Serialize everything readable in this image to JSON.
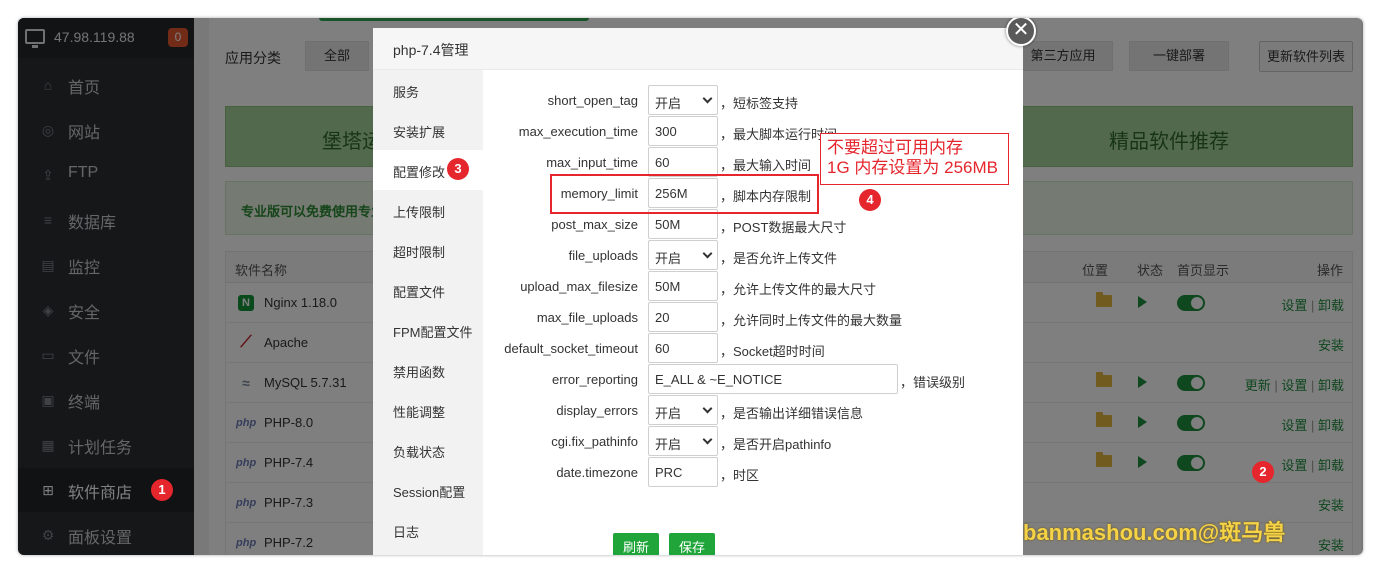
{
  "sidebar": {
    "ip": "47.98.119.88",
    "ip_badge": "0",
    "items": [
      {
        "label": "首页",
        "icon": "home-icon",
        "glyph": "⌂"
      },
      {
        "label": "网站",
        "icon": "globe-icon",
        "glyph": "◎"
      },
      {
        "label": "FTP",
        "icon": "ftp-icon",
        "glyph": "⇪"
      },
      {
        "label": "数据库",
        "icon": "database-icon",
        "glyph": "≡"
      },
      {
        "label": "监控",
        "icon": "monitor-chart-icon",
        "glyph": "▤"
      },
      {
        "label": "安全",
        "icon": "shield-icon",
        "glyph": "◈"
      },
      {
        "label": "文件",
        "icon": "folder-icon",
        "glyph": "▭"
      },
      {
        "label": "终端",
        "icon": "terminal-icon",
        "glyph": "▣"
      },
      {
        "label": "计划任务",
        "icon": "calendar-icon",
        "glyph": "▦"
      },
      {
        "label": "软件商店",
        "icon": "grid-icon",
        "glyph": "⊞"
      },
      {
        "label": "面板设置",
        "icon": "gear-icon",
        "glyph": "⚙"
      }
    ],
    "active_index": 9
  },
  "main": {
    "category_label": "应用分类",
    "categories": [
      "全部",
      "第三方应用",
      "一键部署"
    ],
    "refresh_list": "更新软件列表",
    "banner_left": "堡塔运",
    "banner_right": "精品软件推荐",
    "pro_notice": "专业版可以免费使用专业",
    "table_headers": {
      "name": "软件名称",
      "location": "位置",
      "status": "状态",
      "home": "首页显示",
      "ops": "操作"
    },
    "rows": [
      {
        "name": "Nginx 1.18.0",
        "icon": "N",
        "kind": "nginx",
        "installed": true,
        "ops": [
          "设置",
          "卸载"
        ]
      },
      {
        "name": "Apache",
        "icon": "⟋",
        "kind": "apache",
        "installed": false,
        "ops": [
          "安装"
        ]
      },
      {
        "name": "MySQL 5.7.31",
        "icon": "≈",
        "kind": "mysql",
        "installed": true,
        "ops": [
          "更新",
          "设置",
          "卸载"
        ]
      },
      {
        "name": "PHP-8.0",
        "icon": "php",
        "kind": "php",
        "installed": true,
        "ops": [
          "设置",
          "卸载"
        ]
      },
      {
        "name": "PHP-7.4",
        "icon": "php",
        "kind": "php",
        "installed": true,
        "ops": [
          "设置",
          "卸载"
        ]
      },
      {
        "name": "PHP-7.3",
        "icon": "php",
        "kind": "php",
        "installed": false,
        "ops": [
          "安装"
        ]
      },
      {
        "name": "PHP-7.2",
        "icon": "php",
        "kind": "php",
        "installed": false,
        "ops": [
          "安装"
        ]
      }
    ]
  },
  "modal": {
    "title": "php-7.4管理",
    "close_glyph": "✕",
    "tabs": [
      "服务",
      "安装扩展",
      "配置修改",
      "上传限制",
      "超时限制",
      "配置文件",
      "FPM配置文件",
      "禁用函数",
      "性能调整",
      "负载状态",
      "Session配置",
      "日志"
    ],
    "active_tab": 2,
    "fields": [
      {
        "label": "short_open_tag",
        "value": "开启",
        "type": "select",
        "desc": "，短标签支持"
      },
      {
        "label": "max_execution_time",
        "value": "300",
        "type": "input",
        "desc": "，最大脚本运行时间"
      },
      {
        "label": "max_input_time",
        "value": "60",
        "type": "input",
        "desc": "，最大输入时间"
      },
      {
        "label": "memory_limit",
        "value": "256M",
        "type": "input",
        "desc": "，脚本内存限制"
      },
      {
        "label": "post_max_size",
        "value": "50M",
        "type": "input",
        "desc": "，POST数据最大尺寸"
      },
      {
        "label": "file_uploads",
        "value": "开启",
        "type": "select",
        "desc": "，是否允许上传文件"
      },
      {
        "label": "upload_max_filesize",
        "value": "50M",
        "type": "input",
        "desc": "，允许上传文件的最大尺寸"
      },
      {
        "label": "max_file_uploads",
        "value": "20",
        "type": "input",
        "desc": "，允许同时上传文件的最大数量"
      },
      {
        "label": "default_socket_timeout",
        "value": "60",
        "type": "input",
        "desc": "，Socket超时时间"
      },
      {
        "label": "error_reporting",
        "value": "E_ALL & ~E_NOTICE",
        "type": "wide",
        "desc": "，错误级别"
      },
      {
        "label": "display_errors",
        "value": "开启",
        "type": "select",
        "desc": "，是否输出详细错误信息"
      },
      {
        "label": "cgi.fix_pathinfo",
        "value": "开启",
        "type": "select",
        "desc": "，是否开启pathinfo"
      },
      {
        "label": "date.timezone",
        "value": "PRC",
        "type": "input",
        "desc": "，时区"
      }
    ],
    "refresh_label": "刷新",
    "save_label": "保存"
  },
  "annotations": {
    "note_line1": "不要超过可用内存",
    "note_line2": "1G 内存设置为 256MB",
    "step1": "1",
    "step2": "2",
    "step3": "3",
    "step4": "4",
    "watermark": "banmashou.com@斑马兽",
    "color": "#e5262d"
  }
}
